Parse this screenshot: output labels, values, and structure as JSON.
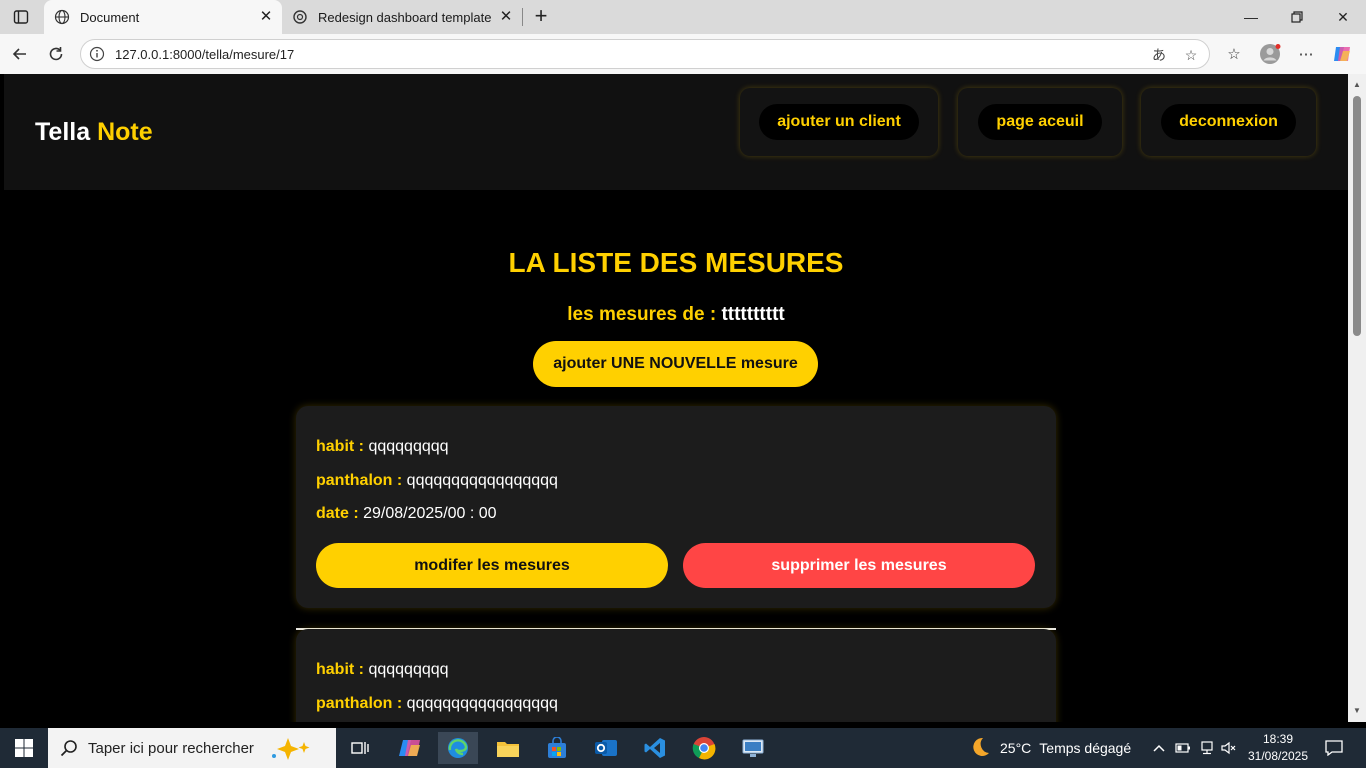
{
  "browser": {
    "tabs": [
      {
        "title": "Document",
        "active": true
      },
      {
        "title": "Redesign dashboard template",
        "active": false
      }
    ],
    "url": "127.0.0.1:8000/tella/mesure/17"
  },
  "site": {
    "logo_primary": "Tella",
    "logo_accent": "Note",
    "nav": [
      {
        "label": "ajouter un client"
      },
      {
        "label": "page aceuil"
      },
      {
        "label": "deconnexion"
      }
    ]
  },
  "main": {
    "title": "LA LISTE DES MESURES",
    "subtitle_label": "les mesures de :",
    "client_name": "tttttttttt",
    "add_button": "ajouter UNE NOUVELLE mesure",
    "cards": [
      {
        "habit_label": "habit :",
        "habit": "qqqqqqqqq",
        "pantalon_label": "panthalon :",
        "pantalon": "qqqqqqqqqqqqqqqqq",
        "date_label": "date :",
        "date": "29/08/2025/00 : 00",
        "edit_button": "modifer les mesures",
        "delete_button": "supprimer les mesures"
      },
      {
        "habit_label": "habit :",
        "habit": "qqqqqqqqq",
        "pantalon_label": "panthalon :",
        "pantalon": "qqqqqqqqqqqqqqqqq"
      }
    ]
  },
  "taskbar": {
    "search_placeholder": "Taper ici pour rechercher",
    "weather_temp": "25°C",
    "weather_desc": "Temps dégagé",
    "time": "18:39",
    "date": "31/08/2025"
  },
  "colors": {
    "accent": "#ffd000",
    "danger": "#ff4545",
    "background": "#000000",
    "card": "#1c1c1c"
  }
}
